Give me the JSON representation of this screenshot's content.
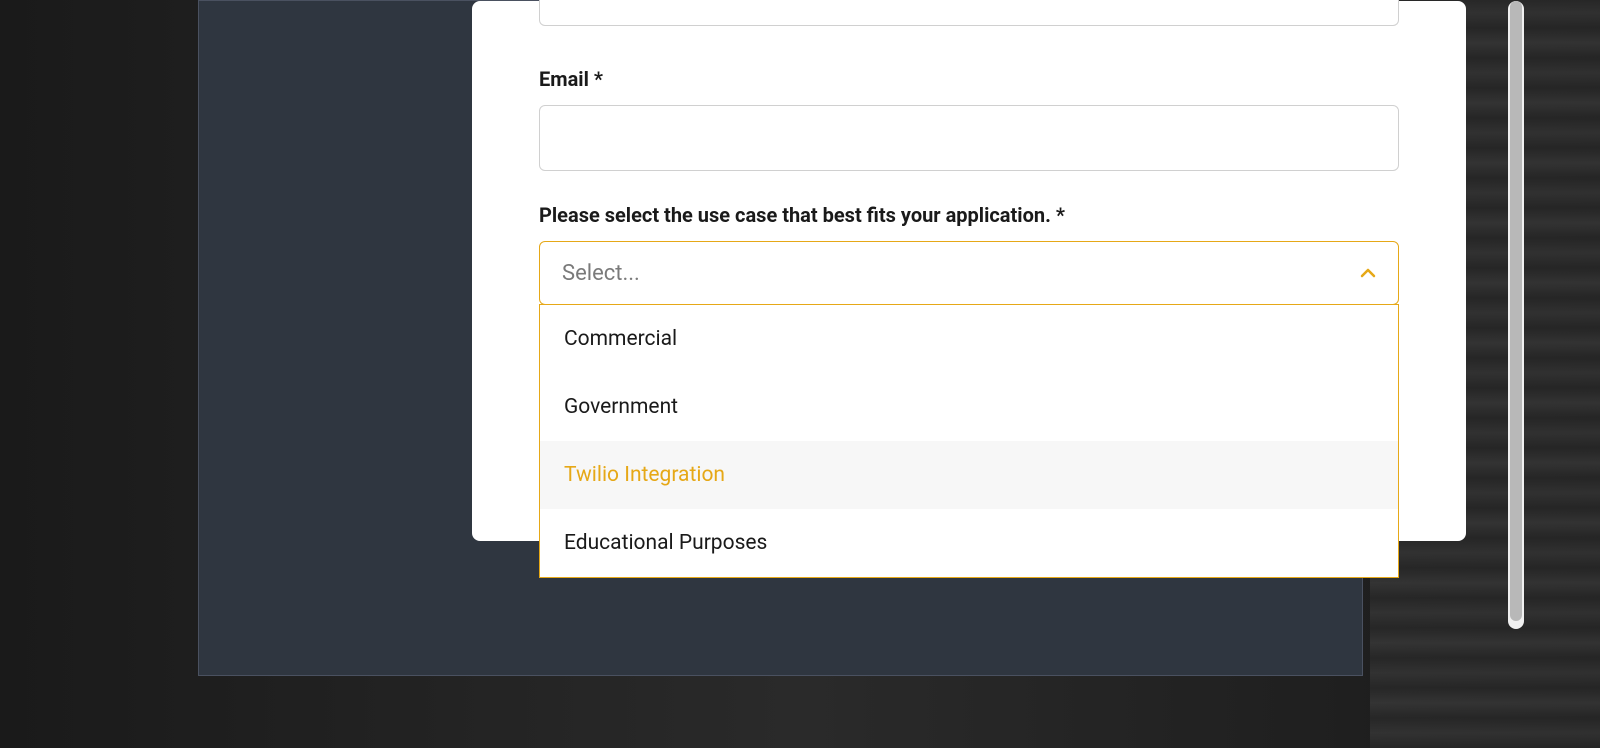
{
  "form": {
    "email_label": "Email *",
    "usecase_label": "Please select the use case that best fits your application. *",
    "select_placeholder": "Select...",
    "options": [
      {
        "label": "Commercial",
        "highlighted": false
      },
      {
        "label": "Government",
        "highlighted": false
      },
      {
        "label": "Twilio Integration",
        "highlighted": true
      },
      {
        "label": "Educational Purposes",
        "highlighted": false
      }
    ]
  },
  "colors": {
    "accent": "#e6a817",
    "text_primary": "#1a1a1a",
    "text_muted": "#7a7a7a",
    "border_default": "#d0d0d0",
    "option_hover_bg": "#f7f7f7"
  }
}
